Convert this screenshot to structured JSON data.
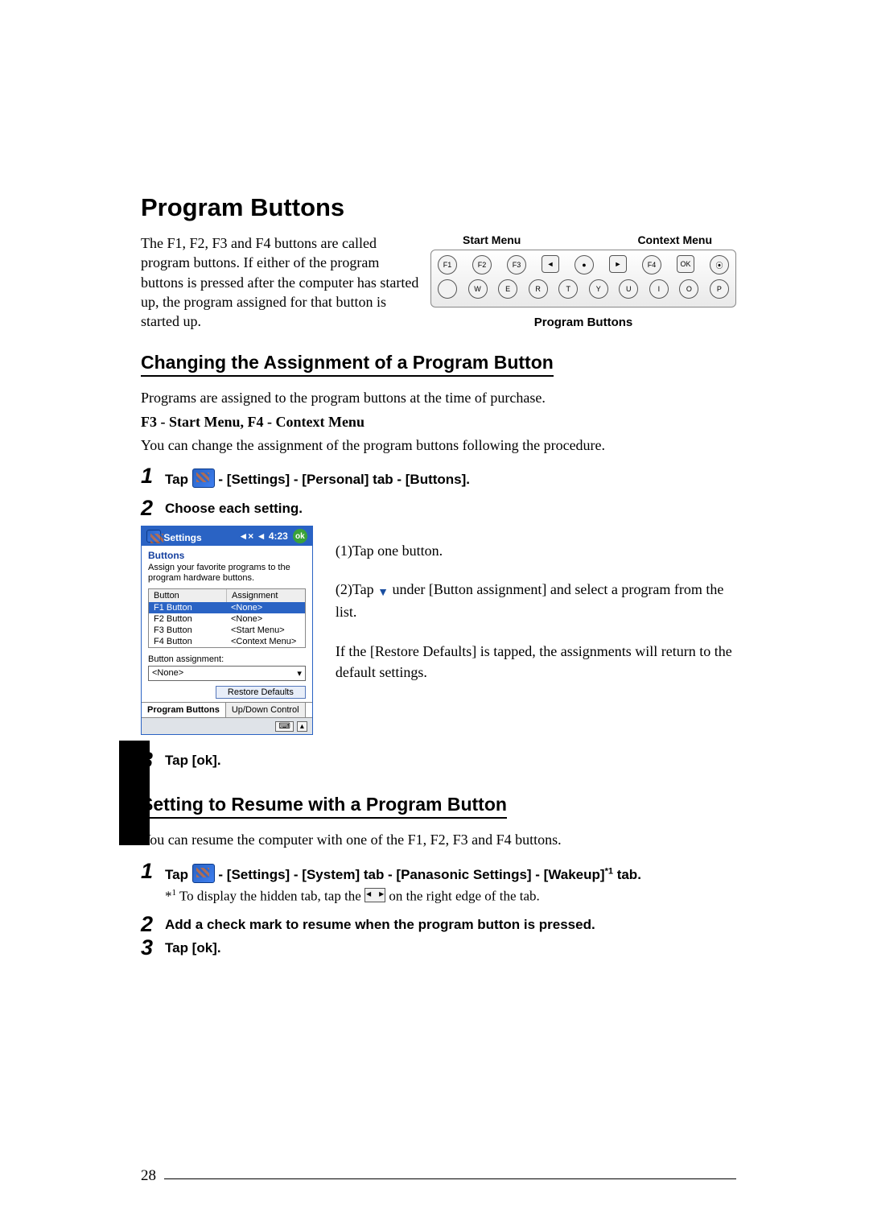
{
  "title": "Program Buttons",
  "intro": "The F1, F2, F3 and F4 buttons are called program buttons. If either of the program buttons is pressed after the computer has started up, the program assigned for that button is started up.",
  "device": {
    "label_left": "Start Menu",
    "label_right": "Context Menu",
    "row1": [
      "F1",
      "F2",
      "F3",
      "◄",
      "●",
      "►",
      "F4",
      "OK",
      "⦿"
    ],
    "row2": [
      "",
      "W",
      "E",
      "R",
      "T",
      "Y",
      "U",
      "I",
      "O",
      "P"
    ],
    "caption": "Program Buttons"
  },
  "section1": {
    "heading": "Changing the Assignment of a Program Button",
    "p1": "Programs are assigned to the program buttons at the time of purchase.",
    "p2": "F3 - Start Menu, F4 - Context Menu",
    "p3": "You can change the assignment of the program buttons following the procedure.",
    "step1": " - [Settings] - [Personal] tab - [Buttons].",
    "step1_prefix": "Tap ",
    "step2": "Choose each setting.",
    "step3": "Tap [ok].",
    "callout1": "(1)Tap one button.",
    "callout2a": "(2)Tap ",
    "callout2b": " under [Button assignment] and select a program from the list.",
    "callout3": "If the [Restore Defaults] is tapped, the assignments will return to the default settings."
  },
  "screenshot": {
    "title": "Settings",
    "clock": "◄× ◄ 4:23",
    "ok": "ok",
    "subtitle": "Buttons",
    "desc": "Assign your favorite programs to the program hardware buttons.",
    "col1": "Button",
    "col2": "Assignment",
    "rows": [
      {
        "b": "F1 Button",
        "a": "<None>",
        "sel": true
      },
      {
        "b": "F2 Button",
        "a": "<None>",
        "sel": false
      },
      {
        "b": "F3 Button",
        "a": "<Start Menu>",
        "sel": false
      },
      {
        "b": "F4 Button",
        "a": "<Context Menu>",
        "sel": false
      }
    ],
    "ba_label": "Button assignment:",
    "ba_value": "<None>",
    "restore": "Restore Defaults",
    "tab1": "Program Buttons",
    "tab2": "Up/Down Control"
  },
  "section2": {
    "heading": "Setting to Resume with a Program Button",
    "p1": "You can resume the computer with one of the F1, F2, F3 and F4 buttons.",
    "step1_prefix": "Tap ",
    "step1": " - [Settings] - [System] tab - [Panasonic Settings] - [Wakeup]",
    "step1_sup": "*1",
    "step1_suffix": "  tab.",
    "note_prefix": "*",
    "note_sup": "1",
    "note_mid": " To display the hidden tab, tap the ",
    "note_end": " on the right edge of the tab.",
    "step2": "Add a check mark to resume when the program button is pressed.",
    "step3": "Tap [ok]."
  },
  "page_number": "28"
}
